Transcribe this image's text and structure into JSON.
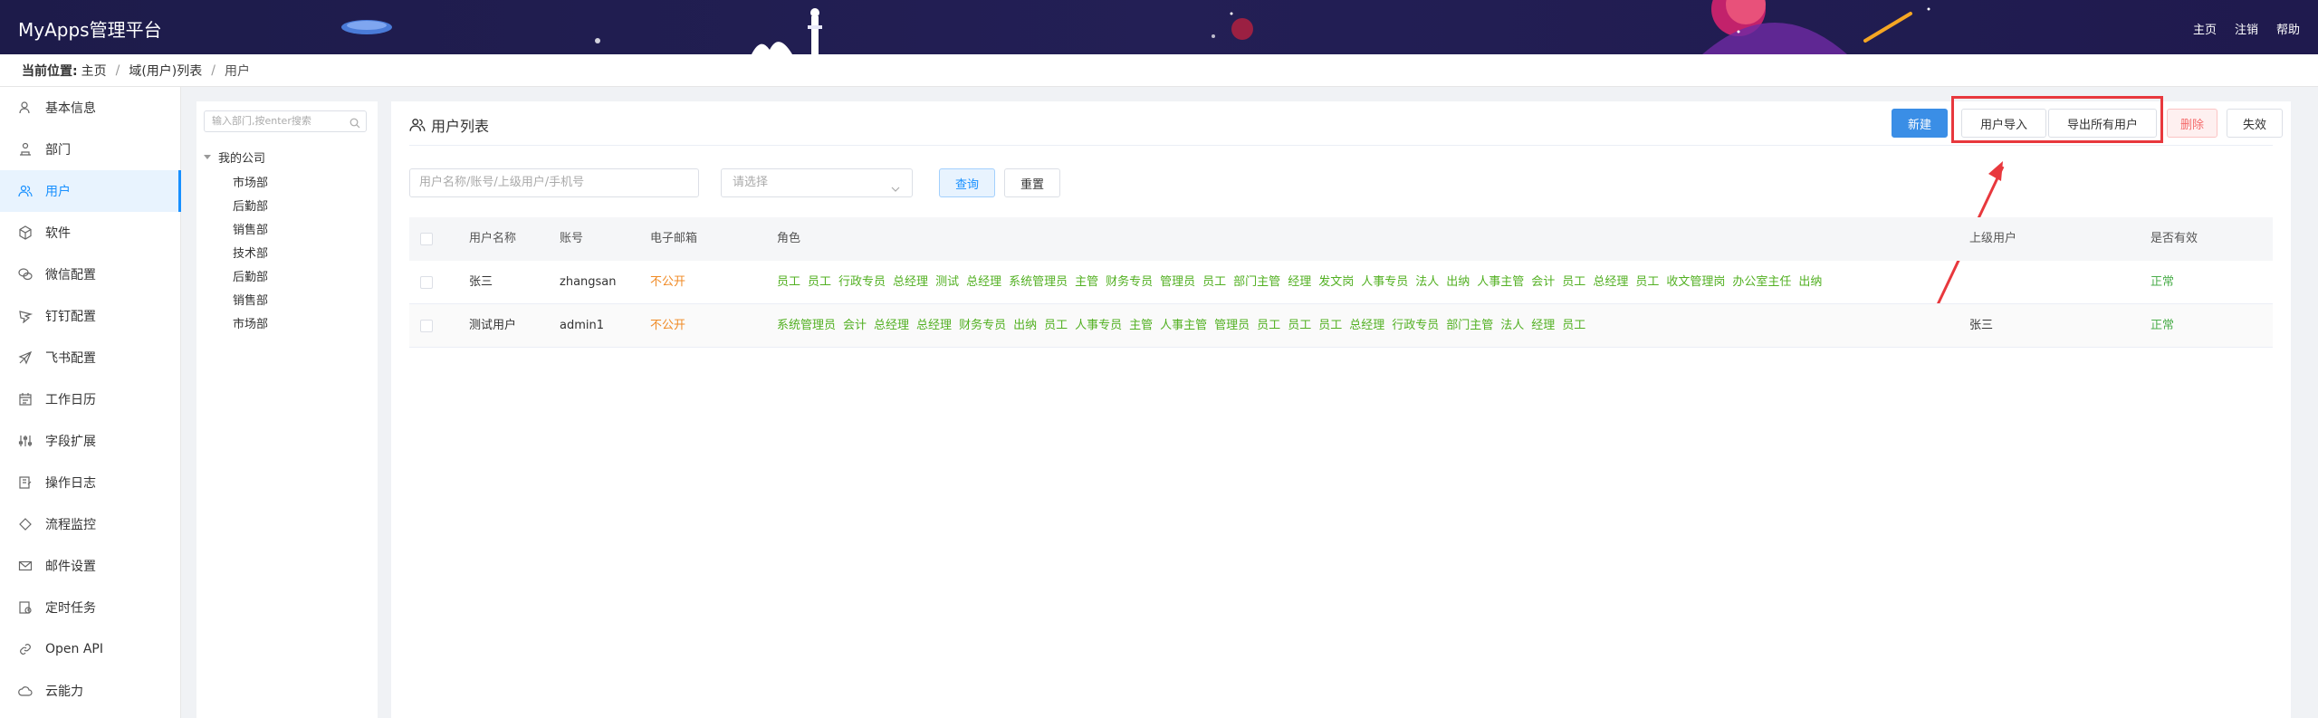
{
  "header": {
    "brand": "MyApps管理平台",
    "links": [
      "主页",
      "注销",
      "帮助"
    ]
  },
  "breadcrumb": {
    "label": "当前位置:",
    "items": [
      "主页",
      "域(用户)列表",
      "用户"
    ]
  },
  "sidebar": {
    "items": [
      {
        "label": "基本信息",
        "icon": "user-info-icon"
      },
      {
        "label": "部门",
        "icon": "department-icon"
      },
      {
        "label": "用户",
        "icon": "users-icon",
        "active": true
      },
      {
        "label": "软件",
        "icon": "cube-icon"
      },
      {
        "label": "微信配置",
        "icon": "wechat-icon"
      },
      {
        "label": "钉钉配置",
        "icon": "dingtalk-icon"
      },
      {
        "label": "飞书配置",
        "icon": "feishu-icon"
      },
      {
        "label": "工作日历",
        "icon": "calendar-icon"
      },
      {
        "label": "字段扩展",
        "icon": "sliders-icon"
      },
      {
        "label": "操作日志",
        "icon": "log-icon"
      },
      {
        "label": "流程监控",
        "icon": "diamond-icon"
      },
      {
        "label": "邮件设置",
        "icon": "mail-icon"
      },
      {
        "label": "定时任务",
        "icon": "timer-icon"
      },
      {
        "label": "Open API",
        "icon": "link-icon"
      },
      {
        "label": "云能力",
        "icon": "cloud-icon"
      }
    ]
  },
  "tree": {
    "search_placeholder": "输入部门,按enter搜索",
    "root": "我的公司",
    "children": [
      "市场部",
      "后勤部",
      "销售部",
      "技术部",
      "后勤部",
      "销售部",
      "市场部"
    ]
  },
  "main": {
    "title": "用户列表",
    "buttons": {
      "new": "新建",
      "import": "用户导入",
      "export": "导出所有用户",
      "delete": "删除",
      "disable": "失效"
    },
    "filter": {
      "search_placeholder": "用户名称/账号/上级用户/手机号",
      "select_placeholder": "请选择",
      "query": "查询",
      "reset": "重置"
    },
    "columns": [
      "用户名称",
      "账号",
      "电子邮箱",
      "角色",
      "上级用户",
      "是否有效"
    ],
    "rows": [
      {
        "name": "张三",
        "account": "zhangsan",
        "email": "不公开",
        "roles": [
          "员工",
          "员工",
          "行政专员",
          "总经理",
          "测试",
          "总经理",
          "系统管理员",
          "主管",
          "财务专员",
          "管理员",
          "员工",
          "部门主管",
          "经理",
          "发文岗",
          "人事专员",
          "法人",
          "出纳",
          "人事主管",
          "会计",
          "员工",
          "总经理",
          "员工",
          "收文管理岗",
          "办公室主任",
          "出纳"
        ],
        "superior": "",
        "status": "正常"
      },
      {
        "name": "测试用户",
        "account": "admin1",
        "email": "不公开",
        "roles": [
          "系统管理员",
          "会计",
          "总经理",
          "总经理",
          "财务专员",
          "出纳",
          "员工",
          "人事专员",
          "主管",
          "人事主管",
          "管理员",
          "员工",
          "员工",
          "员工",
          "总经理",
          "行政专员",
          "部门主管",
          "法人",
          "经理",
          "员工"
        ],
        "superior": "张三",
        "status": "正常"
      }
    ]
  },
  "colors": {
    "header_bg": "#1d1b4a",
    "primary": "#3a8ee6",
    "role_green": "#52b022",
    "email_orange": "#f08a24",
    "highlight_red": "#e8383d"
  }
}
